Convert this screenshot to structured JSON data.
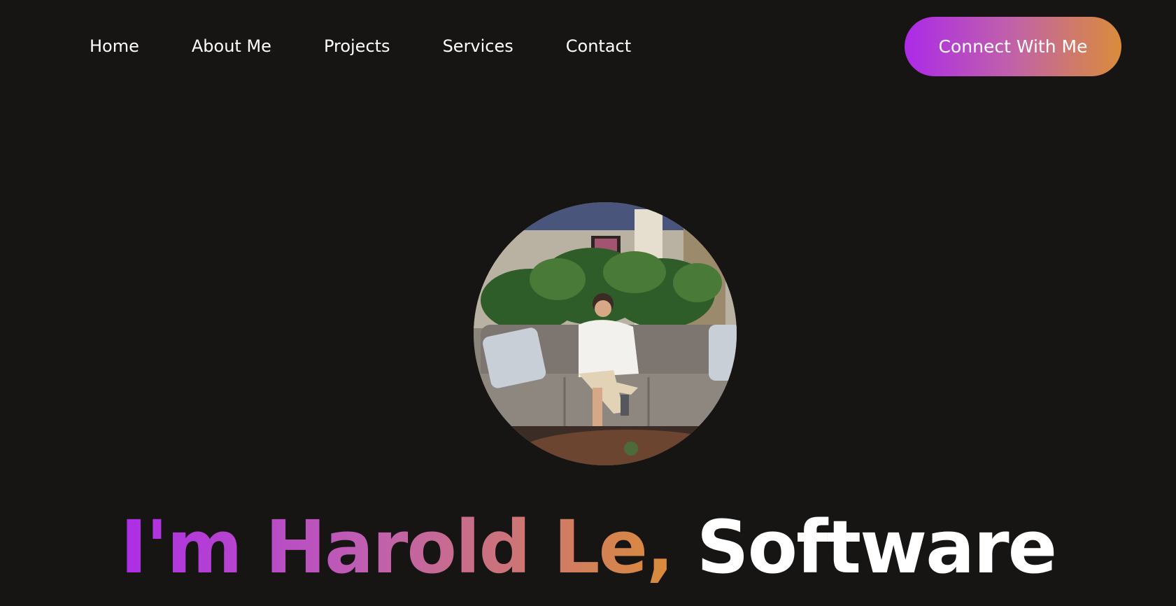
{
  "nav": {
    "links": [
      {
        "label": "Home"
      },
      {
        "label": "About Me"
      },
      {
        "label": "Projects"
      },
      {
        "label": "Services"
      },
      {
        "label": "Contact"
      }
    ],
    "cta_label": "Connect With Me"
  },
  "hero": {
    "title_gradient": "I'm Harold Le,",
    "title_rest": "Software"
  },
  "colors": {
    "background": "#161514",
    "gradient_start": "#ac2ae8",
    "gradient_end": "#da8c3a",
    "text": "#ffffff"
  }
}
